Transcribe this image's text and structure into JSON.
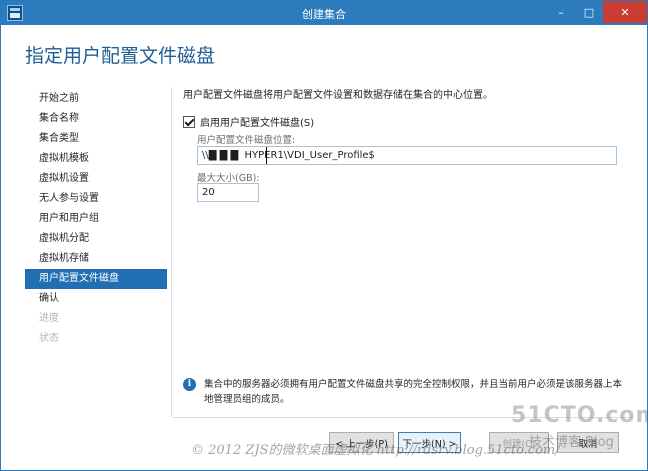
{
  "window": {
    "title": "创建集合",
    "controls": {
      "minimize": "–",
      "maximize": "□",
      "close": "✕"
    },
    "accent": "#2b7bbd"
  },
  "header": {
    "title": "指定用户配置文件磁盘"
  },
  "sidebar": {
    "items": [
      {
        "label": "开始之前",
        "state": "normal"
      },
      {
        "label": "集合名称",
        "state": "normal"
      },
      {
        "label": "集合类型",
        "state": "normal"
      },
      {
        "label": "虚拟机模板",
        "state": "normal"
      },
      {
        "label": "虚拟机设置",
        "state": "normal"
      },
      {
        "label": "无人参与设置",
        "state": "normal"
      },
      {
        "label": "用户和用户组",
        "state": "normal"
      },
      {
        "label": "虚拟机分配",
        "state": "normal"
      },
      {
        "label": "虚拟机存储",
        "state": "normal"
      },
      {
        "label": "用户配置文件磁盘",
        "state": "active"
      },
      {
        "label": "确认",
        "state": "normal"
      },
      {
        "label": "进度",
        "state": "disabled"
      },
      {
        "label": "状态",
        "state": "disabled"
      }
    ],
    "active_color": "#1f6fb2"
  },
  "main": {
    "description": "用户配置文件磁盘将用户配置文件设置和数据存储在集合的中心位置。",
    "enable_checkbox": {
      "label": "启用用户配置文件磁盘(S)",
      "checked": true
    },
    "location": {
      "label": "用户配置文件磁盘位置:",
      "value": "\\\\█ █ █  HYPER1\\VDI_User_Profile$"
    },
    "max_size": {
      "label": "最大大小(GB):",
      "value": "20"
    }
  },
  "info": {
    "icon": "info-icon",
    "text": "集合中的服务器必须拥有用户配置文件磁盘共享的完全控制权限，并且当前用户必须是该服务器上本地管理员组的成员。"
  },
  "footer": {
    "prev_label": "< 上一步(P)",
    "next_label": "下一步(N) >",
    "create_label": "创建(C)",
    "cancel_label": "取消"
  },
  "watermark": {
    "text": "© 2012 ZJS的微软桌面虚拟化 http://rdsrv.blog.51cto.com/",
    "logo": "51CTO.com",
    "logo_sub": "技术博客 Blog"
  }
}
